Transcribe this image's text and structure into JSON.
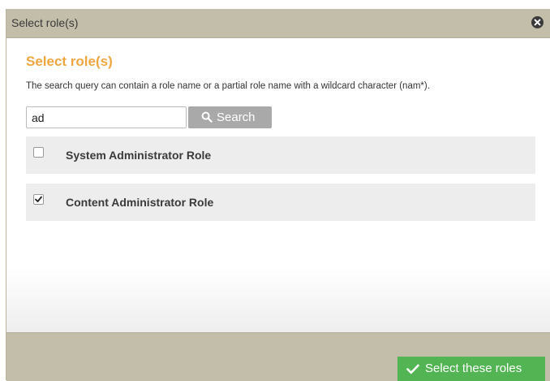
{
  "dialog": {
    "title": "Select role(s)",
    "heading": "Select role(s)",
    "hint": "The search query can contain a role name or a partial role name with a wildcard character (nam*).",
    "search": {
      "value": "ad",
      "button_label": "Search"
    },
    "roles": [
      {
        "label": "System Administrator Role",
        "checked": false
      },
      {
        "label": "Content Administrator Role",
        "checked": true
      }
    ],
    "footer": {
      "select_label": "Select these roles"
    }
  },
  "colors": {
    "titlebar": "#c3bea9",
    "heading": "#f0a640",
    "search_button": "#a9a9a9",
    "select_button": "#53b454",
    "row_background": "#ededed"
  },
  "icons": {
    "close": "close-icon",
    "search": "search-icon",
    "checkmark": "checkmark-icon"
  }
}
